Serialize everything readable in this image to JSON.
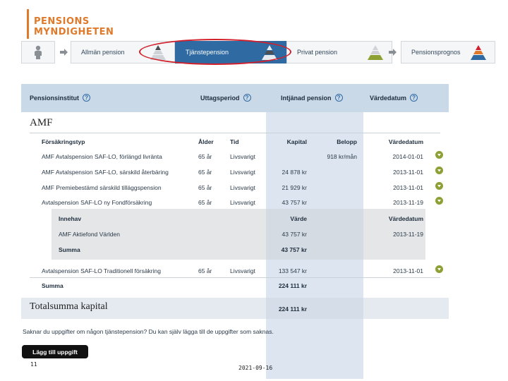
{
  "logo": {
    "line1": "PENSIONS",
    "line2": "MYNDIGHETEN"
  },
  "steps": {
    "allman": "Allmän pension",
    "tjanste": "Tjänstepension",
    "privat": "Privat pension",
    "prognos": "Pensionsprognos"
  },
  "table": {
    "headers": {
      "institute": "Pensionsinstitut",
      "period": "Uttagsperiod",
      "earned": "Intjänad pension",
      "valuedate": "Värdedatum"
    },
    "institute_name": "AMF",
    "columns": {
      "type": "Försäkringstyp",
      "age": "Ålder",
      "time": "Tid",
      "capital": "Kapital",
      "amount": "Belopp",
      "valuedate": "Värdedatum"
    },
    "rows": [
      {
        "type": "AMF Avtalspension SAF-LO, förlängd livränta",
        "age": "65 år",
        "time": "Livsvarigt",
        "capital": "",
        "amount": "918 kr/mån",
        "date": "2014-01-01"
      },
      {
        "type": "AMF Avtalspension SAF-LO, särskild återbäring",
        "age": "65 år",
        "time": "Livsvarigt",
        "capital": "24 878 kr",
        "amount": "",
        "date": "2013-11-01"
      },
      {
        "type": "AMF Premiebestämd särskild tilläggspension",
        "age": "65 år",
        "time": "Livsvarigt",
        "capital": "21 929 kr",
        "amount": "",
        "date": "2013-11-01"
      },
      {
        "type": "Avtalspension SAF-LO ny Fondförsäkring",
        "age": "65 år",
        "time": "Livsvarigt",
        "capital": "43 757 kr",
        "amount": "",
        "date": "2013-11-19"
      }
    ],
    "holdings": {
      "header_left": "Innehav",
      "header_value": "Värde",
      "header_date": "Värdedatum",
      "item_name": "AMF Aktiefond Världen",
      "item_value": "43 757 kr",
      "item_date": "2013-11-19",
      "sum_label": "Summa",
      "sum_value": "43 757 kr"
    },
    "row5": {
      "type": "Avtalspension SAF-LO Traditionell försäkring",
      "age": "65 år",
      "time": "Livsvarigt",
      "capital": "133 547 kr",
      "date": "2013-11-01"
    },
    "sum_label": "Summa",
    "sum_value": "224 111 kr",
    "total_label": "Totalsumma kapital",
    "total_value": "224 111 kr"
  },
  "missing_text": "Saknar du uppgifter om någon tjänstepension? Du kan själv lägga till de uppgifter som saknas.",
  "add_button": "Lägg till uppgift",
  "footer": {
    "page": "11",
    "date": "2021-09-16"
  },
  "colors": {
    "brand": "#e07a2a",
    "accent": "#2f6aa3",
    "expand": "#8ca033",
    "highlight": "#d2202b"
  }
}
